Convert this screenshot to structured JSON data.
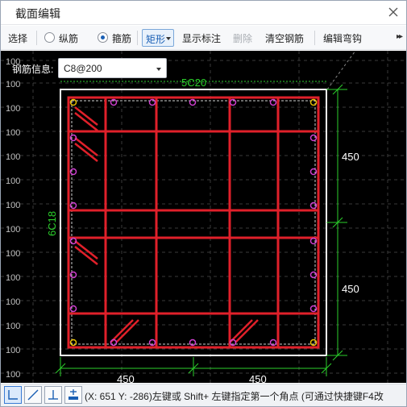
{
  "window": {
    "title": "截面编辑",
    "close_icon": "close-icon"
  },
  "toolbar": {
    "select_label": "选择",
    "longitudinal_label": "纵筋",
    "stirrup_label": "箍筋",
    "shape_value": "矩形",
    "show_annotation_label": "显示标注",
    "delete_label": "删除",
    "clear_rebar_label": "清空钢筋",
    "edit_hook_label": "编辑弯钩",
    "more_icon": "chevron-double-right-icon",
    "selected_mode": "stirrup"
  },
  "rebar_info": {
    "label": "钢筋信息:",
    "value": "C8@200"
  },
  "drawing": {
    "top_rebar_label": "5C20",
    "side_rebar_label": "6C18",
    "dim_right_upper": "450",
    "dim_right_lower": "450",
    "dim_bottom_left": "450",
    "dim_bottom_right": "450",
    "grid_labels": [
      "100",
      "100",
      "100",
      "100",
      "100",
      "100",
      "100",
      "100",
      "100",
      "100",
      "100",
      "100",
      "100",
      "100"
    ],
    "colors": {
      "background": "#000000",
      "section_outline": "#ffffff",
      "stirrup": "#e0202a",
      "rebar_dot": "#d040d0",
      "corner_dot": "#e8c000",
      "dimension": "#2bd02b",
      "grid": "#3a3a3a"
    }
  },
  "statusbar": {
    "snap_icons": [
      "ortho-snap-icon",
      "line-snap-icon",
      "perpendicular-snap-icon",
      "point-snap-icon"
    ],
    "message": "(X: 651 Y: -286)左键或 Shift+ 左键指定第一个角点 (可通过快捷键F4改"
  }
}
